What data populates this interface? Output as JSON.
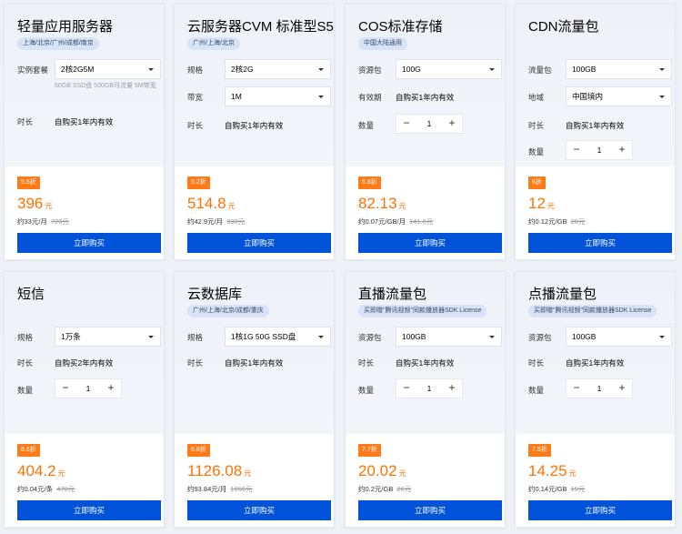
{
  "cards": [
    {
      "title": "轻量应用服务器",
      "tag": "上海/北京/广州/成都/南京",
      "rows": [
        {
          "label": "实例套餐",
          "value": "2核2G5M"
        },
        {
          "label": "时长",
          "value": "自购买1年内有效"
        }
      ],
      "note": "50GB SSD盘 500GB月流量 5M带宽",
      "discount": "5.5折",
      "price": "396",
      "unit": "元",
      "sub_price": "约33元/月",
      "orig_price": "720元",
      "buy_label": "立即购买"
    },
    {
      "title": "云服务器CVM 标准型S5",
      "tag": "广州/上海/北京",
      "rows": [
        {
          "label": "规格",
          "value": "2核2G"
        },
        {
          "label": "带宽",
          "value": "1M"
        },
        {
          "label": "时长",
          "value": "自购买1年内有效"
        }
      ],
      "discount": "5.2折",
      "price": "514.8",
      "unit": "元",
      "sub_price": "约42.9元/月",
      "orig_price": "990元",
      "buy_label": "立即购买"
    },
    {
      "title": "COS标准存储",
      "tag": "中国大陆通用",
      "rows": [
        {
          "label": "资源包",
          "value": "100G"
        },
        {
          "label": "有效期",
          "value": "自购买1年内有效"
        },
        {
          "label": "数量",
          "value": "1"
        }
      ],
      "stepper": {
        "minus": "−",
        "plus": "+"
      },
      "discount": "5.8折",
      "price": "82.13",
      "unit": "元",
      "sub_price": "约0.07元/GB/月",
      "orig_price": "141.6元",
      "buy_label": "立即购买"
    },
    {
      "title": "CDN流量包",
      "rows": [
        {
          "label": "流量包",
          "value": "100GB"
        },
        {
          "label": "地域",
          "value": "中国境内"
        },
        {
          "label": "时长",
          "value": "自购买1年内有效"
        },
        {
          "label": "数量",
          "value": "1"
        }
      ],
      "stepper": {
        "minus": "−",
        "plus": "+"
      },
      "discount": "6折",
      "price": "12",
      "unit": "元",
      "sub_price": "约0.12元/GB",
      "orig_price": "20元",
      "buy_label": "立即购买"
    },
    {
      "title": "短信",
      "rows": [
        {
          "label": "规格",
          "value": "1万条"
        },
        {
          "label": "时长",
          "value": "自购买2年内有效"
        },
        {
          "label": "数量",
          "value": "1"
        }
      ],
      "stepper": {
        "minus": "−",
        "plus": "+"
      },
      "discount": "8.6折",
      "price": "404.2",
      "unit": "元",
      "sub_price": "约0.04元/条",
      "orig_price": "470元",
      "buy_label": "立即购买"
    },
    {
      "title": "云数据库",
      "tag": "广州/上海/北京/成都/重庆",
      "rows": [
        {
          "label": "规格",
          "value": "1核1G 50G SSD盘"
        },
        {
          "label": "时长",
          "value": "自购买1年内有效"
        }
      ],
      "discount": "6.8折",
      "price": "1126.08",
      "unit": "元",
      "sub_price": "约93.84元/月",
      "orig_price": "1656元",
      "buy_label": "立即购买"
    },
    {
      "title": "直播流量包",
      "tag": "买即赠\"腾讯视频\"同款播放器SDK License",
      "rows": [
        {
          "label": "资源包",
          "value": "100GB"
        },
        {
          "label": "时长",
          "value": "自购买1年内有效"
        },
        {
          "label": "数量",
          "value": "1"
        }
      ],
      "stepper": {
        "minus": "−",
        "plus": "+"
      },
      "discount": "7.7折",
      "price": "20.02",
      "unit": "元",
      "sub_price": "约0.2元/GB",
      "orig_price": "26元",
      "buy_label": "立即购买"
    },
    {
      "title": "点播流量包",
      "tag": "买即赠\"腾讯视频\"同款播放器SDK License",
      "rows": [
        {
          "label": "资源包",
          "value": "100GB"
        },
        {
          "label": "时长",
          "value": "自购买1年内有效"
        },
        {
          "label": "数量",
          "value": "1"
        }
      ],
      "stepper": {
        "minus": "−",
        "plus": "+"
      },
      "discount": "7.5折",
      "price": "14.25",
      "unit": "元",
      "sub_price": "约0.14元/GB",
      "orig_price": "19元",
      "buy_label": "立即购买"
    }
  ],
  "colors": {
    "accent_blue": "#0052d9",
    "price_orange": "#ff7200",
    "discount_orange": "#ff7a18",
    "tag_bg": "#d7e3f7"
  }
}
